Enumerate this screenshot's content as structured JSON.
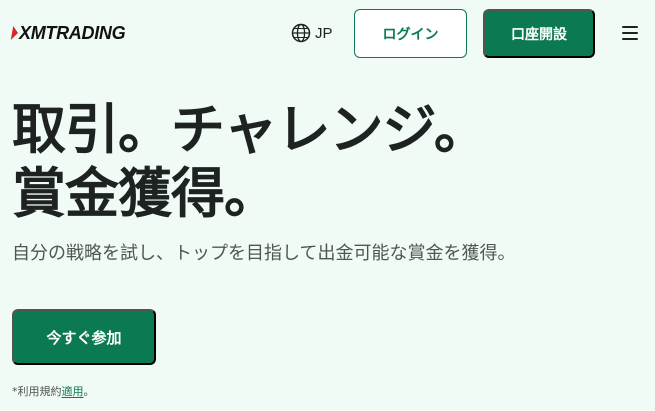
{
  "header": {
    "logo_text": "XMTRADING",
    "language_label": "JP",
    "login_label": "ログイン",
    "open_account_label": "口座開設"
  },
  "hero": {
    "title_line1": "取引。チャレンジ。",
    "title_line2": "賞金獲得。",
    "subtitle": "自分の戦略を試し、トップを目指して出金可能な賞金を獲得。",
    "cta_label": "今すぐ参加",
    "terms_prefix": "*利用規約",
    "terms_link": "適用",
    "terms_suffix": "。"
  },
  "colors": {
    "background": "#f0fbf5",
    "brand_green": "#0b7a51",
    "logo_red": "#d5272e",
    "text": "#1e2321",
    "muted_text": "#4f5753"
  },
  "icons": {
    "language": "globe-icon",
    "menu": "hamburger-menu-icon",
    "logo_mark": "xm-logo-mark-icon"
  }
}
